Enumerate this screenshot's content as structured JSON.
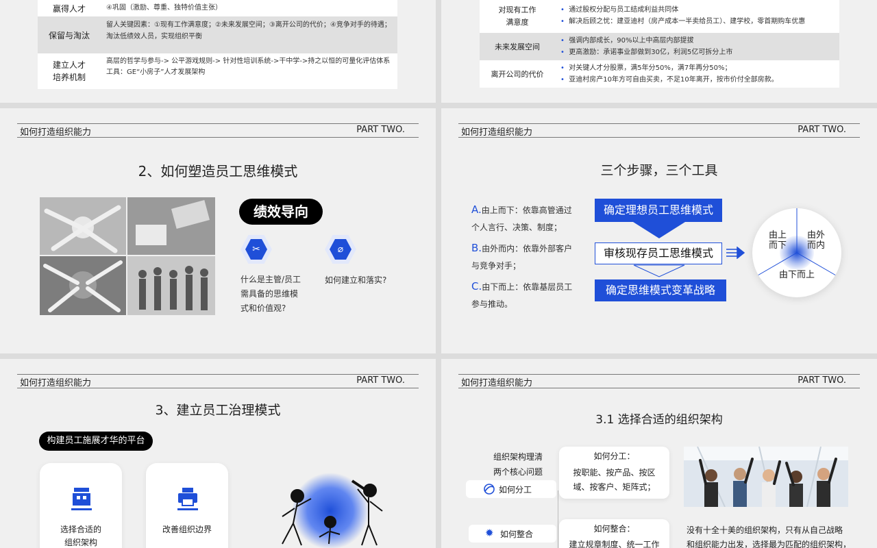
{
  "top_left": {
    "row0": {
      "left": "赢得人才",
      "right": "④巩固（激励、尊重、独特价值主张）"
    },
    "row1": {
      "left": "保留与淘汰",
      "right_a": "留人关键因素：①现有工作满意度；②未来发展空间；③离开公司的代价；④竞争对手的待遇；",
      "right_b": "淘汰低绩效人员，实现组织平衡"
    },
    "row2": {
      "left_a": "建立人才",
      "left_b": "培养机制",
      "right_a": "高层的哲学与参与-> 公平游戏规则-> 针对性培训系统->干中学->持之以恒的可量化评估体系",
      "right_b": "工具：GE“小房子”人才发展架构"
    }
  },
  "top_right": {
    "row0": {
      "left_a": "对现有工作",
      "left_b": "满意度",
      "items": [
        "通过股权分配与员工结成利益共同体",
        "解决后顾之忧：建亚迪村（房产成本一半卖给员工）、建学校，零首期购车优惠"
      ]
    },
    "row1": {
      "left": "未来发展空间",
      "items": [
        "强调内部成长，90%以上中高层内部提拔",
        "更高激励：承诺事业部做到30亿，利润5亿可拆分上市"
      ]
    },
    "row2": {
      "left": "离开公司的代价",
      "items": [
        "对关键人才分股票，满5年分50%，满7年再分50%；",
        "亚迪村房产10年方可自由买卖，不足10年离开，按市价付全部房款。"
      ]
    }
  },
  "header": {
    "left": "如何打造组织能力",
    "right": "PART TWO."
  },
  "mid_left": {
    "title": "2、如何塑造员工思维模式",
    "pill": "绩效导向",
    "q1": [
      "什么是主管/员工",
      "需具备的思维模",
      "式和价值观?"
    ],
    "q2": "如何建立和落实?"
  },
  "mid_right": {
    "title": "三个步骤，三个工具",
    "steps": [
      {
        "letter": "A.",
        "line1": "由上而下：依靠高管通过",
        "line2": "个人言行、决策、制度；"
      },
      {
        "letter": "B.",
        "line1": "由外而内：依靠外部客户",
        "line2": "与竞争对手；"
      },
      {
        "letter": "C.",
        "line1": "由下而上：依靠基层员工",
        "line2": "参与推动。"
      }
    ],
    "boxes": [
      "确定理想员工思维模式",
      "审核现存员工思维模式",
      "确定思维模式变革战略"
    ],
    "circle": {
      "a": [
        "由上",
        "而下"
      ],
      "b": [
        "由外",
        "而内"
      ],
      "c": "由下而上"
    }
  },
  "bot_left": {
    "title": "3、建立员工治理模式",
    "pill": "构建员工施展才华的平台",
    "card1": [
      "选择合适的",
      "组织架构"
    ],
    "card2": "改善组织边界"
  },
  "bot_right": {
    "title": "3.1 选择合适的组织架构",
    "core": [
      "组织架构理清",
      "两个核心问题"
    ],
    "tag1": "如何分工",
    "tag2": "如何整合",
    "box1_title": "如何分工：",
    "box1_text": [
      "按职能、按产品、按区",
      "域、按客户、矩阵式；"
    ],
    "box2_title": "如何整合：",
    "box2_text": "建立规章制度、统一工作",
    "para": [
      "没有十全十美的组织架构，只有从自己战略",
      "和组织能力出发，选择最为匹配的组织架构，"
    ]
  },
  "colors": {
    "accent": "#1f4fd8",
    "bg": "#f0f0f0",
    "dark": "#000000"
  }
}
